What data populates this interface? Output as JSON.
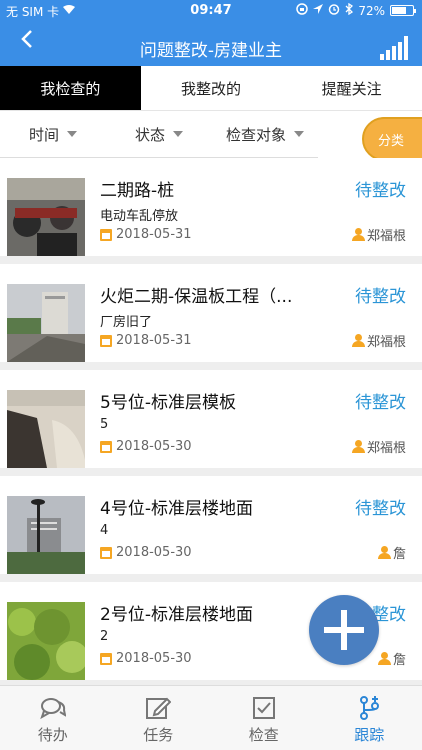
{
  "status_bar": {
    "carrier": "无 SIM 卡",
    "time": "09:47",
    "battery": "72%",
    "battery_level": 0.72
  },
  "header": {
    "title": "问题整改-房建业主",
    "back_icon": "chevron-left-icon"
  },
  "tabs": [
    {
      "label": "我检查的",
      "active": true
    },
    {
      "label": "我整改的",
      "active": false
    },
    {
      "label": "提醒关注",
      "active": false
    }
  ],
  "filters": [
    {
      "label": "时间"
    },
    {
      "label": "状态"
    },
    {
      "label": "检查对象"
    }
  ],
  "classify_label": "分类",
  "items": [
    {
      "title": "二期路-桩",
      "desc": "电动车乱停放",
      "date": "2018-05-31",
      "status": "待整改",
      "person": "郑福根"
    },
    {
      "title": "火炬二期-保温板工程（...",
      "desc": "厂房旧了",
      "date": "2018-05-31",
      "status": "待整改",
      "person": "郑福根"
    },
    {
      "title": "5号位-标准层模板",
      "desc": "5",
      "date": "2018-05-30",
      "status": "待整改",
      "person": "郑福根"
    },
    {
      "title": "4号位-标准层楼地面",
      "desc": "4",
      "date": "2018-05-30",
      "status": "待整改",
      "person": "詹"
    },
    {
      "title": "2号位-标准层楼地面",
      "desc": "2",
      "date": "2018-05-30",
      "status": "待整改",
      "person": "詹"
    }
  ],
  "bottom_nav": [
    {
      "label": "待办",
      "icon": "chat-icon",
      "active": false
    },
    {
      "label": "任务",
      "icon": "edit-icon",
      "active": false
    },
    {
      "label": "检查",
      "icon": "checkbox-icon",
      "active": false
    },
    {
      "label": "跟踪",
      "icon": "track-icon",
      "active": true
    }
  ],
  "colors": {
    "primary": "#3a8ee6",
    "status": "#2b95d6",
    "accent": "#f5a623",
    "fab": "#4a7fc1"
  }
}
